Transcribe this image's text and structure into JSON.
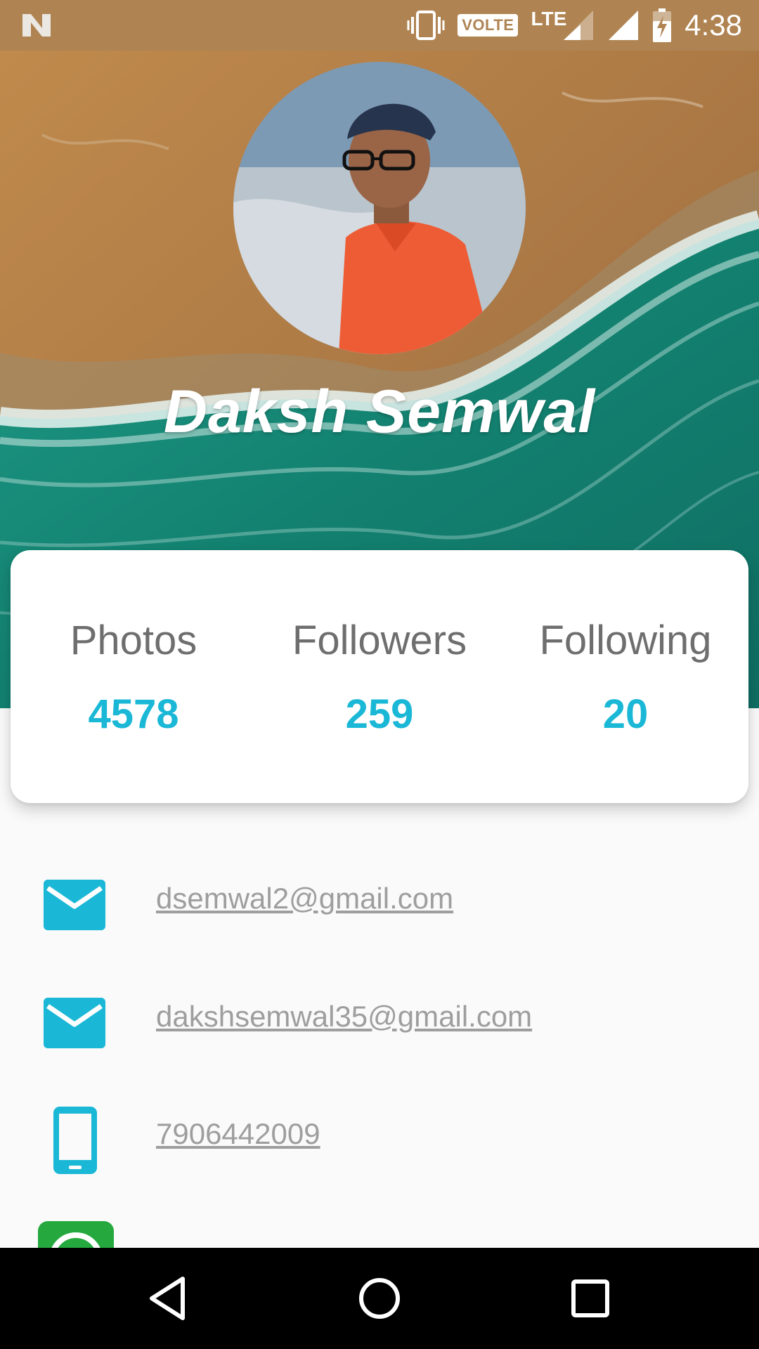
{
  "status_bar": {
    "volte": "VOLTE",
    "network": "LTE",
    "time": "4:38",
    "icons": [
      "notification-n-icon",
      "vibrate-icon",
      "signal-icon",
      "battery-charging-icon"
    ]
  },
  "profile": {
    "name": "Daksh Semwal",
    "avatar_icon": "profile-photo"
  },
  "stats": [
    {
      "label": "Photos",
      "value": "4578"
    },
    {
      "label": "Followers",
      "value": "259"
    },
    {
      "label": "Following",
      "value": "20"
    }
  ],
  "contacts": [
    {
      "icon": "email-icon",
      "text": "dsemwal2@gmail.com"
    },
    {
      "icon": "email-icon",
      "text": "dakshsemwal35@gmail.com"
    },
    {
      "icon": "phone-icon",
      "text": "7906442009"
    },
    {
      "icon": "whatsapp-icon",
      "text": ""
    }
  ],
  "nav_bar": {
    "icons": [
      "back-icon",
      "home-icon",
      "recents-icon"
    ]
  },
  "colors": {
    "status_bar": "#b08452",
    "accent": "#1ab8d6",
    "label": "#6e6e6e",
    "link": "#9e9e9e",
    "whatsapp": "#25a93f"
  }
}
